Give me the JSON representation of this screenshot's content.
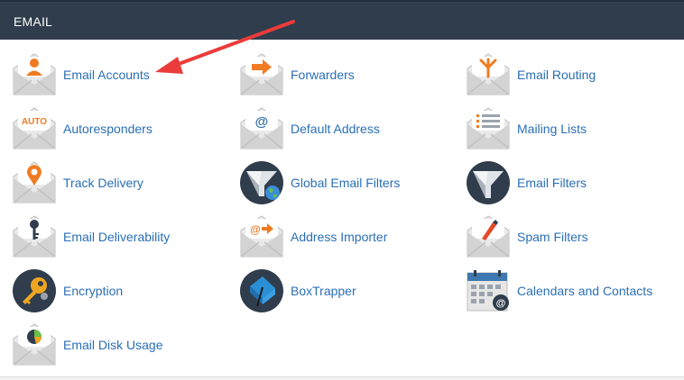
{
  "header": {
    "title": "EMAIL"
  },
  "items": [
    {
      "label": "Email Accounts",
      "icon": "email-accounts-icon"
    },
    {
      "label": "Forwarders",
      "icon": "forwarders-icon"
    },
    {
      "label": "Email Routing",
      "icon": "email-routing-icon"
    },
    {
      "label": "Autoresponders",
      "icon": "autoresponders-icon",
      "icon_text": "AUTO"
    },
    {
      "label": "Default Address",
      "icon": "default-address-icon"
    },
    {
      "label": "Mailing Lists",
      "icon": "mailing-lists-icon"
    },
    {
      "label": "Track Delivery",
      "icon": "track-delivery-icon"
    },
    {
      "label": "Global Email Filters",
      "icon": "global-email-filters-icon"
    },
    {
      "label": "Email Filters",
      "icon": "email-filters-icon"
    },
    {
      "label": "Email Deliverability",
      "icon": "email-deliverability-icon"
    },
    {
      "label": "Address Importer",
      "icon": "address-importer-icon"
    },
    {
      "label": "Spam Filters",
      "icon": "spam-filters-icon"
    },
    {
      "label": "Encryption",
      "icon": "encryption-icon"
    },
    {
      "label": "BoxTrapper",
      "icon": "boxtrapper-icon"
    },
    {
      "label": "Calendars and Contacts",
      "icon": "calendars-and-contacts-icon"
    },
    {
      "label": "Email Disk Usage",
      "icon": "email-disk-usage-icon"
    }
  ],
  "annotation": {
    "type": "red-arrow",
    "points_to": "Email Accounts",
    "color": "#ec3b3b"
  },
  "colors": {
    "header_bg": "#2f3d4c",
    "link": "#2a6fb5",
    "accent_orange": "#f07b22"
  }
}
